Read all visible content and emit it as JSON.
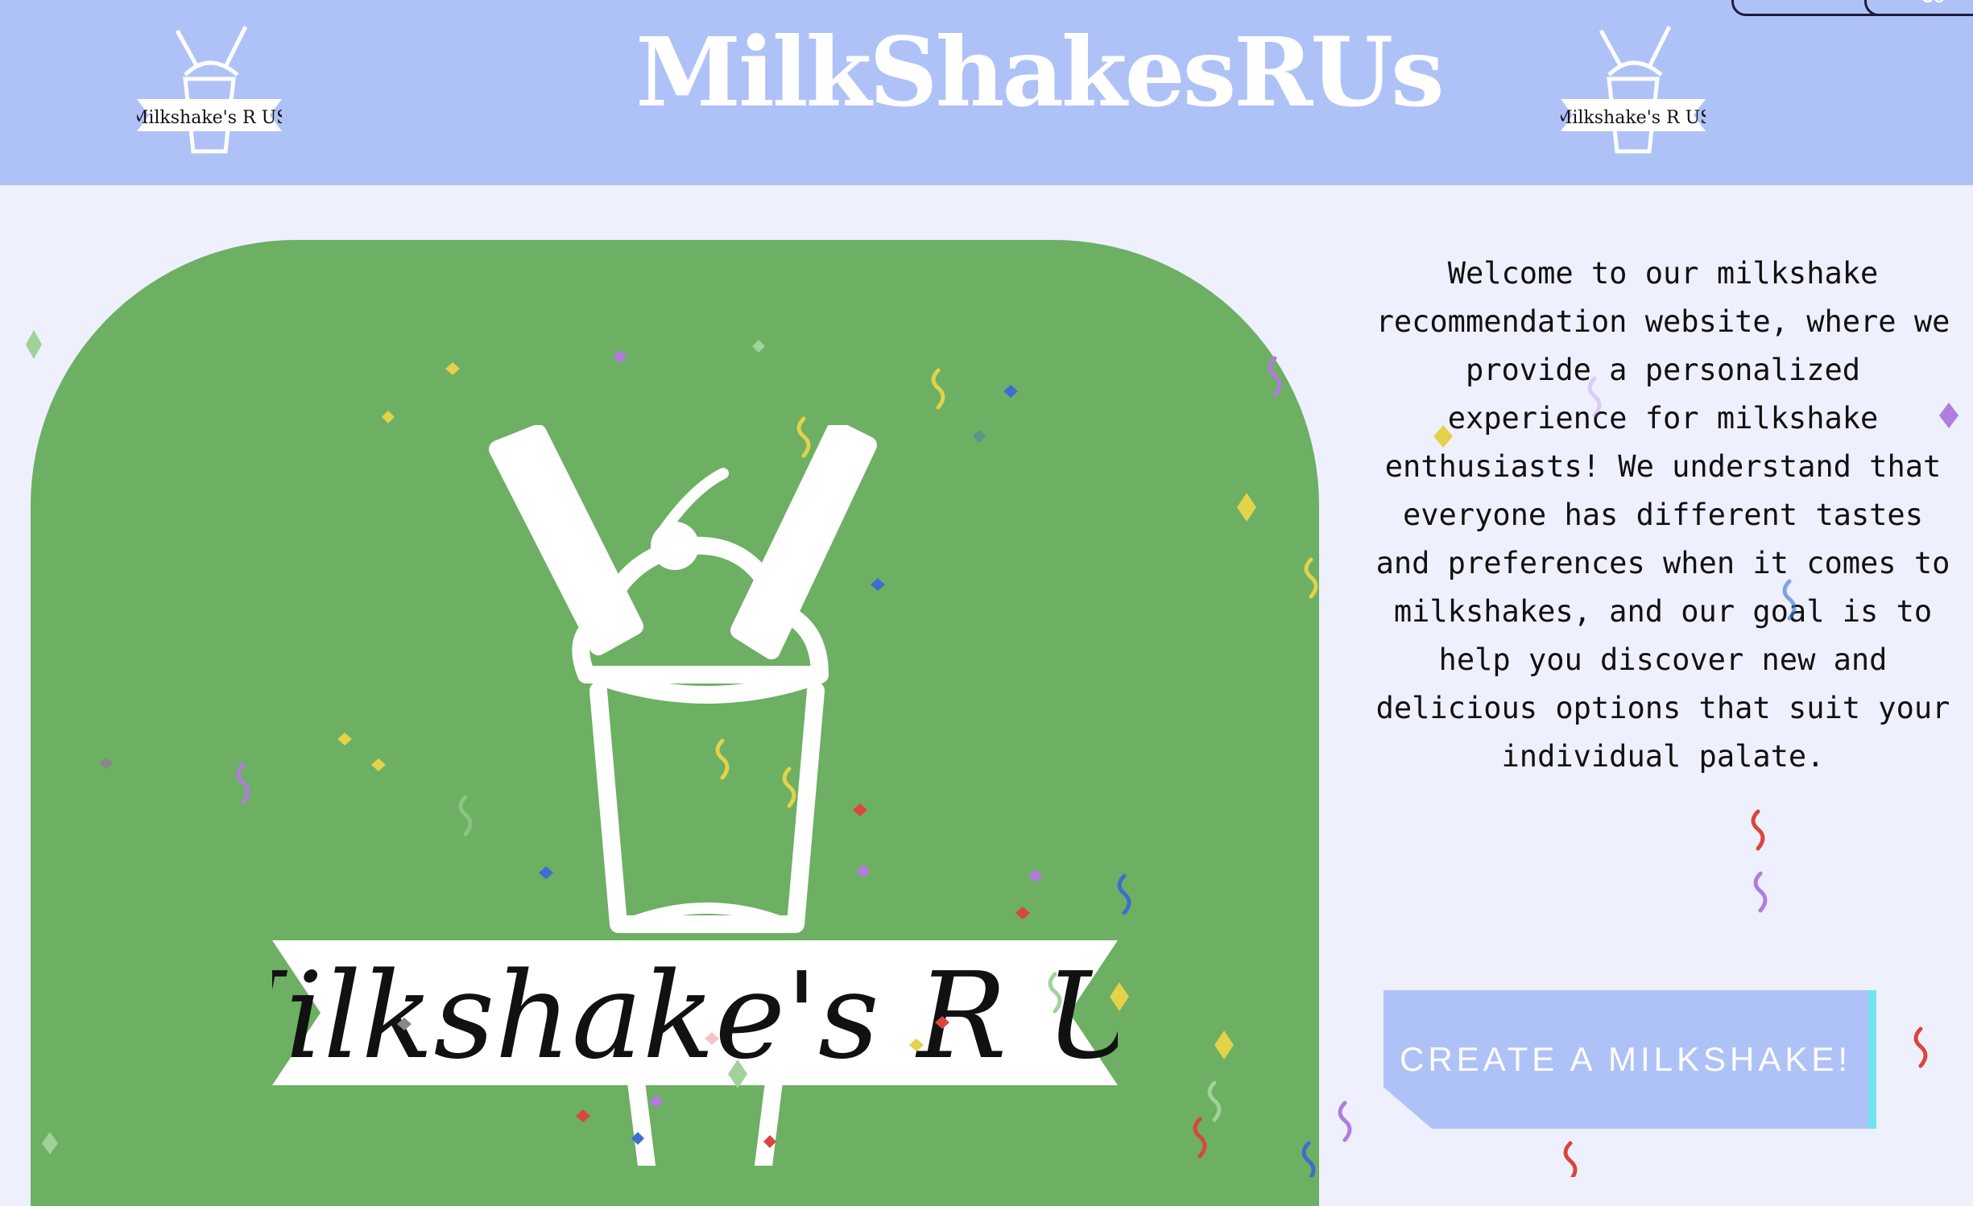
{
  "header": {
    "title": "MilkShakesRUs",
    "logo_text": "Milkshake's R US",
    "nav_1": "",
    "nav_2": "Us"
  },
  "hero": {
    "logo_text": "Milkshake's R US"
  },
  "welcome_text": "Welcome to our milkshake recommendation website, where we provide a personalized experience for milkshake enthusiasts! We understand that everyone has different tastes and preferences when it comes to milkshakes, and our goal is to help you discover new and delicious options that suit your individual palate.",
  "cta": {
    "label": "CREATE A MILKSHAKE!"
  },
  "colors": {
    "header": "#afc2f8",
    "hero": "#6daf63",
    "background": "#eef0fd",
    "cta_accent": "#6fe3f0"
  }
}
